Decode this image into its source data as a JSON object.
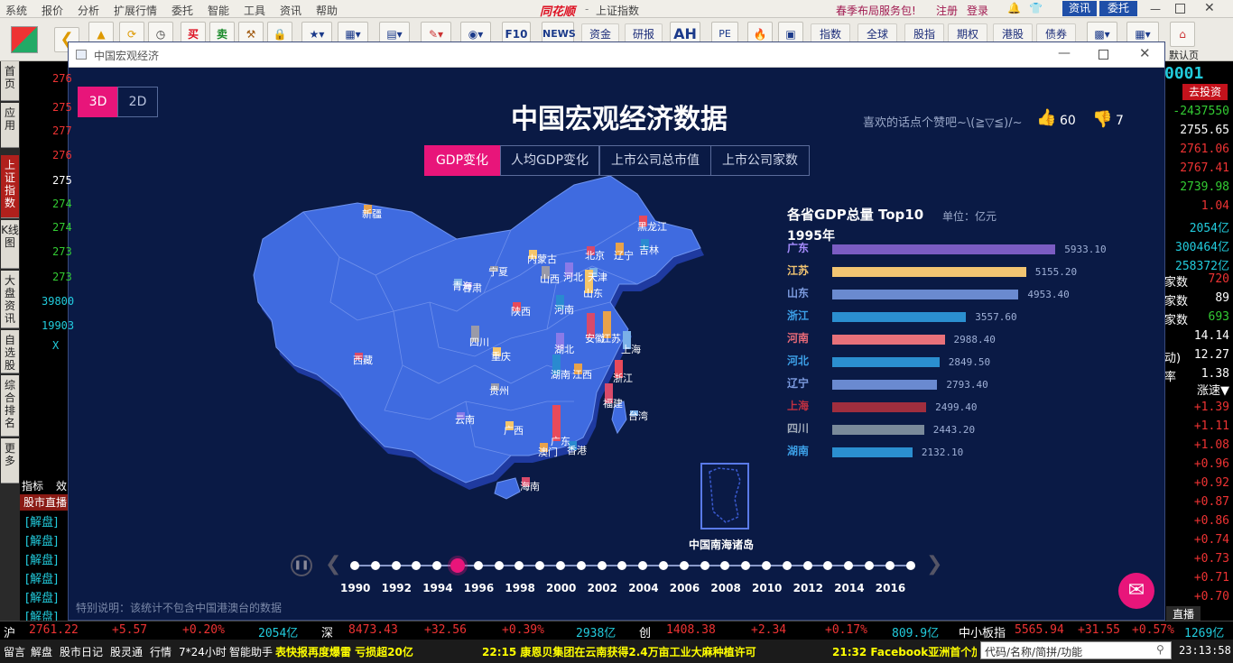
{
  "menu": [
    "系统",
    "报价",
    "分析",
    "扩展行情",
    "委托",
    "智能",
    "工具",
    "资讯",
    "帮助"
  ],
  "app": {
    "logo": "同花顺",
    "title": "上证指数",
    "promo": "春季布局服务包!",
    "register": "注册",
    "login": "登录",
    "news_btn": "资讯",
    "trade_btn": "委托",
    "default_page": "默认页"
  },
  "toolbar": {
    "buy": "买",
    "sell": "卖",
    "zixun_f10": "F10",
    "news": "NEWS",
    "fund": "资金",
    "research": "研报",
    "ah": "AH",
    "pe": "PE",
    "index": "指数",
    "global": "全球",
    "stock": "股指",
    "futures": "期权",
    "hk": "港股",
    "bond": "债券"
  },
  "leftnav": [
    {
      "label": "首页",
      "active": false
    },
    {
      "label": "应用",
      "active": false
    },
    {
      "label": "上证指数",
      "active": true
    },
    {
      "label": "K线图",
      "active": false
    },
    {
      "label": "大盘资讯",
      "active": false
    },
    {
      "label": "自选股",
      "active": false
    },
    {
      "label": "综合排名",
      "active": false
    },
    {
      "label": "更多",
      "active": false
    }
  ],
  "leftnums": [
    {
      "v": "276",
      "c": "#e33"
    },
    {
      "v": "275",
      "c": "#e33"
    },
    {
      "v": "277",
      "c": "#e33"
    },
    {
      "v": "276",
      "c": "#e33"
    },
    {
      "v": "275",
      "c": "#fff"
    },
    {
      "v": "274",
      "c": "#3c3"
    },
    {
      "v": "274",
      "c": "#3c3"
    },
    {
      "v": "273",
      "c": "#3c3"
    },
    {
      "v": "273",
      "c": "#3c3"
    },
    {
      "v": "39800",
      "c": "#2cd"
    },
    {
      "v": "19903",
      "c": "#2cd"
    },
    {
      "v": "X",
      "c": "#2cd"
    }
  ],
  "leftbottom": {
    "tab1": "指标",
    "tab2": "效",
    "live": "股市直播",
    "items": [
      "[解盘]",
      "[解盘]",
      "[解盘]",
      "[解盘]",
      "[解盘]",
      "[解盘]"
    ]
  },
  "rightpanel": {
    "code": "0001",
    "invest": "去投资",
    "values": [
      {
        "v": "-2437550",
        "c": "#3c3"
      },
      {
        "v": "2755.65",
        "c": "#fff"
      },
      {
        "v": "2761.06",
        "c": "#e33"
      },
      {
        "v": "2767.41",
        "c": "#e33"
      },
      {
        "v": "2739.98",
        "c": "#3c3"
      },
      {
        "v": "1.04",
        "c": "#e33"
      },
      {
        "v": "2054亿",
        "c": "#2cd"
      },
      {
        "v": "300464亿",
        "c": "#2cd"
      },
      {
        "v": "258372亿",
        "c": "#2cd"
      }
    ],
    "stats": [
      {
        "l": "家数",
        "v": "720",
        "c": "#e33"
      },
      {
        "l": "家数",
        "v": "89",
        "c": "#fff"
      },
      {
        "l": "家数",
        "v": "693",
        "c": "#3c3"
      },
      {
        "l": "",
        "v": "14.14",
        "c": "#fff"
      },
      {
        "l": "动)",
        "v": "12.27",
        "c": "#fff"
      },
      {
        "l": "率",
        "v": "1.38",
        "c": "#fff"
      }
    ],
    "speed": "涨速",
    "speeds": [
      "+1.39",
      "+1.11",
      "+1.08",
      "+0.96",
      "+0.92",
      "+0.87",
      "+0.86",
      "+0.74",
      "+0.73",
      "+0.71",
      "+0.70"
    ],
    "live": "直播"
  },
  "window": {
    "title": "中国宏观经济",
    "heading": "中国宏观经济数据",
    "like_text": "喜欢的话点个赞吧~\\(≧▽≦)/~",
    "likes": "60",
    "dislikes": "7",
    "toggle_3d": "3D",
    "toggle_2d": "2D",
    "tabs": [
      "GDP变化",
      "人均GDP变化",
      "上市公司总市值",
      "上市公司家数"
    ],
    "note": "特别说明：该统计不包含中国港澳台的数据",
    "south_sea": "中国南海诸岛"
  },
  "chart_data": {
    "type": "bar",
    "title": "各省GDP总量 Top10",
    "unit": "单位：亿元",
    "year": "1995年",
    "categories": [
      "广东",
      "江苏",
      "山东",
      "浙江",
      "河南",
      "河北",
      "辽宁",
      "上海",
      "四川",
      "湖南"
    ],
    "values": [
      5933.1,
      5155.2,
      4953.4,
      3557.6,
      2988.4,
      2849.5,
      2793.4,
      2499.4,
      2443.2,
      2132.1
    ],
    "colors": [
      "#7b5cc2",
      "#f2c572",
      "#6a8ad0",
      "#2b8fd0",
      "#e8717a",
      "#2b8fd0",
      "#6a8ad0",
      "#a02e3e",
      "#7a8a9a",
      "#2b8fd0"
    ],
    "label_colors": [
      "#a68cff",
      "#f2c572",
      "#7d9ce0",
      "#3ca0e8",
      "#e86a78",
      "#3ca0e8",
      "#7d9ce0",
      "#c03040",
      "#a0aab8",
      "#3ca0e8"
    ],
    "xlim": [
      0,
      6000
    ]
  },
  "map_labels": [
    "新疆",
    "西藏",
    "青海",
    "甘肃",
    "宁夏",
    "内蒙古",
    "黑龙江",
    "吉林",
    "辽宁",
    "北京",
    "天津",
    "河北",
    "山西",
    "山东",
    "陕西",
    "河南",
    "江苏",
    "安徽",
    "上海",
    "湖北",
    "四川",
    "重庆",
    "浙江",
    "湖南",
    "江西",
    "福建",
    "台湾",
    "云南",
    "贵州",
    "广西",
    "广东",
    "香港",
    "澳门",
    "海南"
  ],
  "timeline": {
    "years": [
      "1990",
      "1992",
      "1994",
      "1996",
      "1998",
      "2000",
      "2002",
      "2004",
      "2006",
      "2008",
      "2010",
      "2012",
      "2014",
      "2016"
    ],
    "current": "1995"
  },
  "statusbar": {
    "sh_label": "沪",
    "sh_val": "2761.22",
    "sh_chg": "+5.57",
    "sh_pct": "+0.20%",
    "sh_amt": "2054亿",
    "sz_label": "深",
    "sz_val": "8473.43",
    "sz_chg": "+32.56",
    "sz_pct": "+0.39%",
    "sz_amt": "2938亿",
    "cy_label": "创",
    "cy_val": "1408.38",
    "cy_chg": "+2.34",
    "cy_pct": "+0.17%",
    "cy_amt": "809.9亿",
    "zx_label": "中小板指",
    "zx_val": "5565.94",
    "zx_chg": "+31.55",
    "zx_pct": "+0.57%",
    "zx_amt": "1269亿"
  },
  "bottombar": {
    "items": [
      "留言",
      "解盘",
      "股市日记",
      "股灵通",
      "行情",
      "7*24小时",
      "智能助手"
    ],
    "ticker1": "表快报再度爆雷 亏损超20亿",
    "ticker2": "22:15 康恩贝集团在云南获得2.4万亩工业大麻种植许可",
    "ticker3": "21:32 Facebook亚洲首个加",
    "search": "代码/名称/简拼/功能",
    "time": "23:13:58"
  }
}
